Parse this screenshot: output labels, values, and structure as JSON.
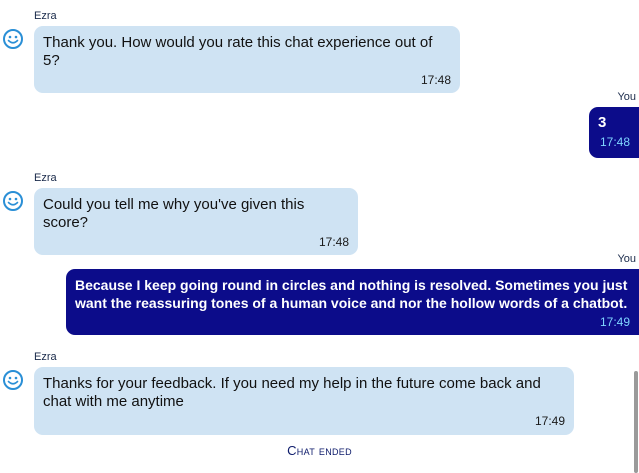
{
  "colors": {
    "bot_bubble": "#cfe3f3",
    "user_bubble": "#0c0c8a",
    "user_time": "#7fd4ff",
    "avatar": "#2a8fd6"
  },
  "messages": [
    {
      "sender": "Ezra",
      "text": "Thank you. How would you rate this chat experience out of 5?",
      "time": "17:48",
      "icon": "smiley-icon"
    },
    {
      "sender": "You",
      "text": "3",
      "time": "17:48"
    },
    {
      "sender": "Ezra",
      "text": "Could you tell me why you've given this score?",
      "time": "17:48",
      "icon": "smiley-icon"
    },
    {
      "sender": "You",
      "text": "Because I keep going round in circles and nothing is resolved. Sometimes you just want the reassuring tones of a human voice and nor the hollow words of a chatbot.",
      "time": "17:49"
    },
    {
      "sender": "Ezra",
      "text": "Thanks for your feedback. If you need my help in the future come back and chat with me anytime",
      "time": "17:49",
      "icon": "smiley-icon"
    }
  ],
  "status": {
    "chat_ended": "Chat ended"
  }
}
